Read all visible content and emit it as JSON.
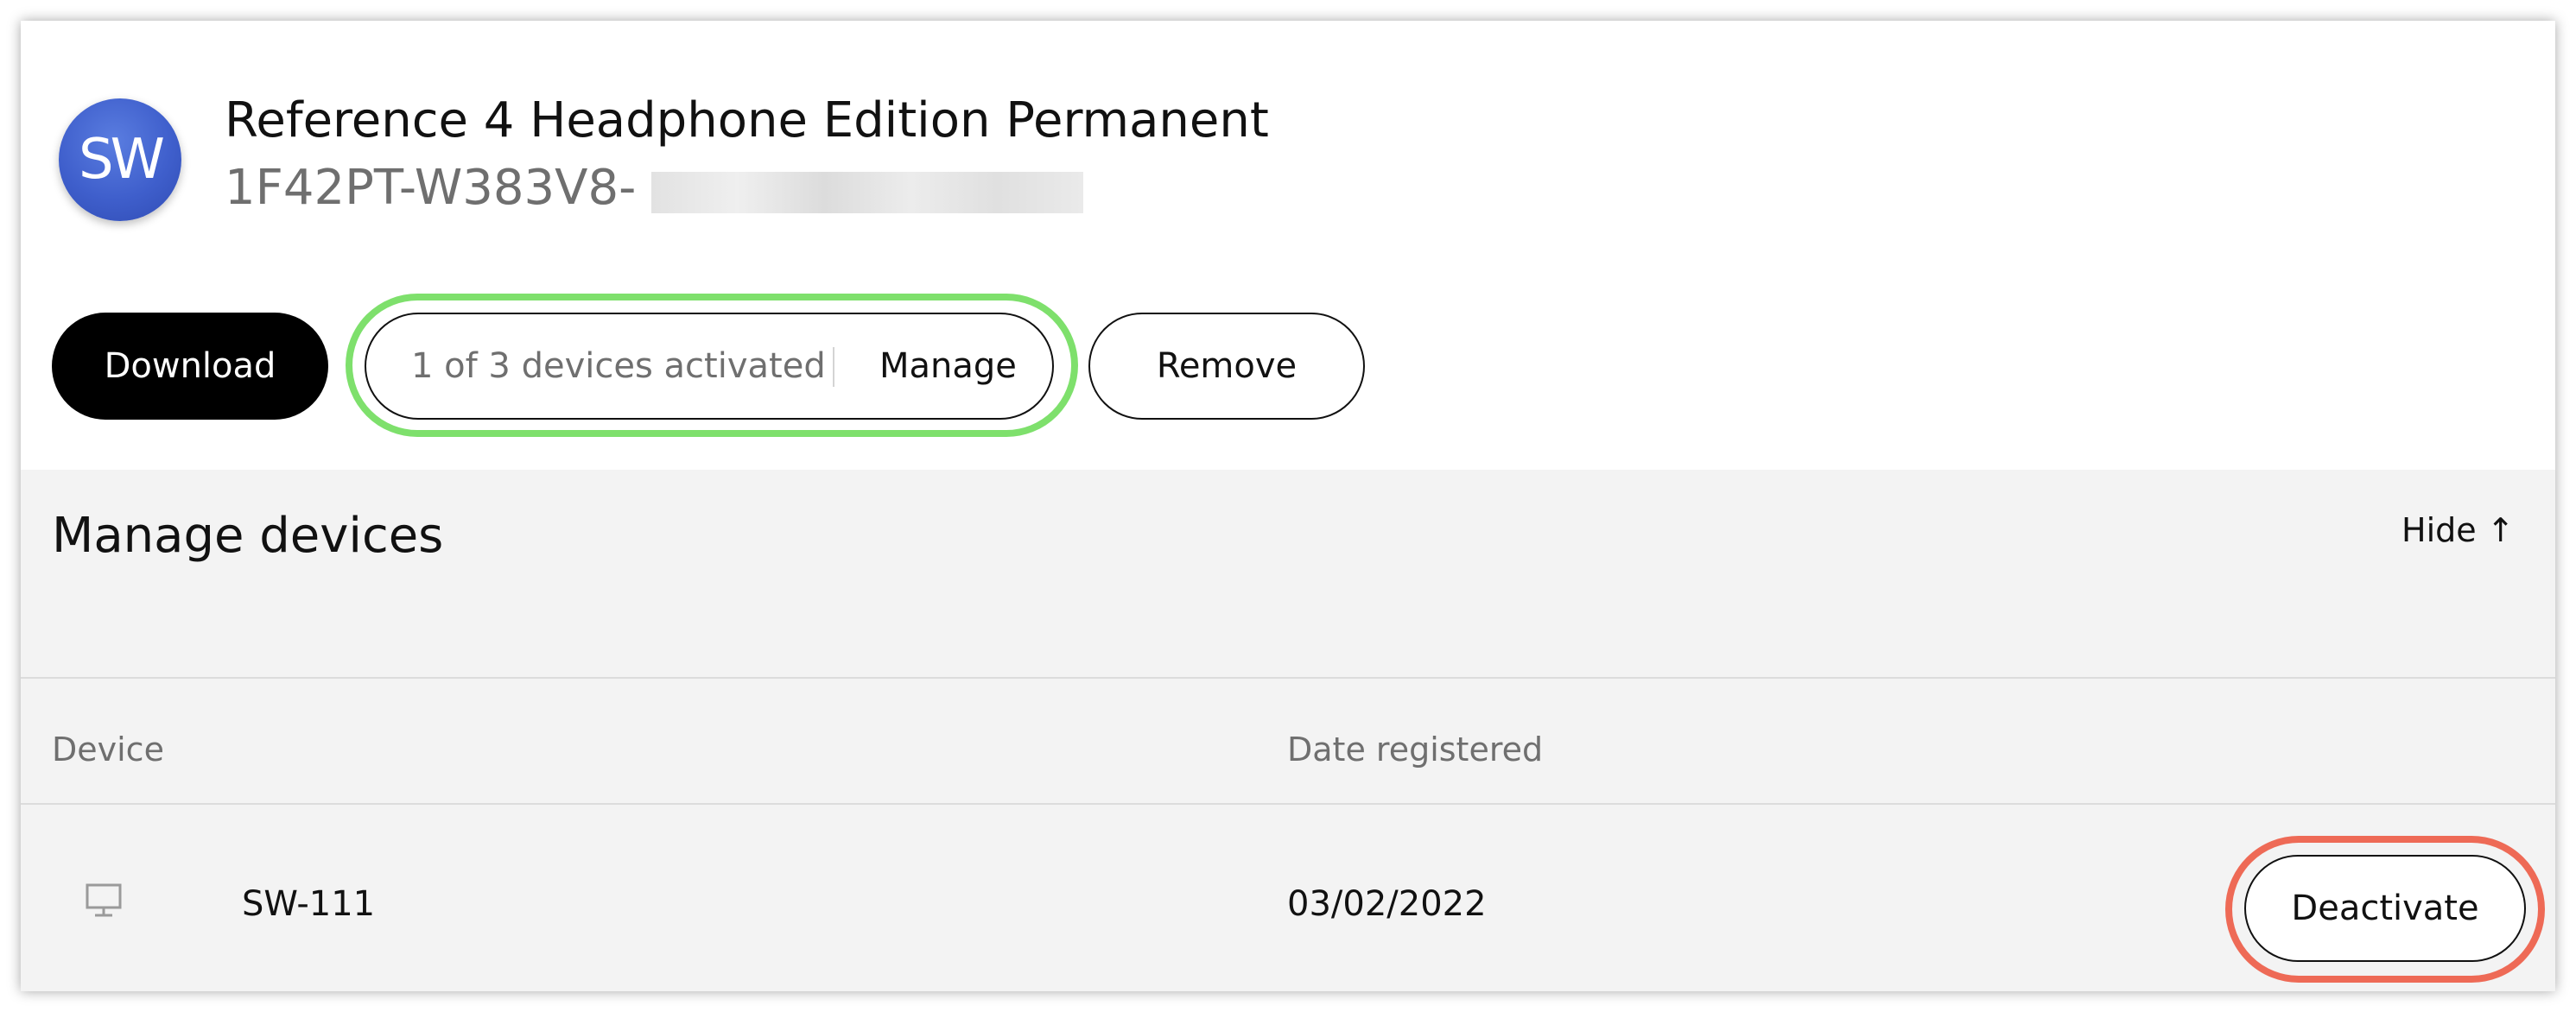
{
  "product": {
    "logo_text": "SW",
    "title": "Reference 4 Headphone Edition Permanent",
    "serial_visible": "1F42PT-W383V8-"
  },
  "actions": {
    "download_label": "Download",
    "activation_count": "1 of 3 devices activated",
    "manage_label": "Manage",
    "remove_label": "Remove"
  },
  "manage_devices": {
    "title": "Manage devices",
    "hide_label": "Hide ↑",
    "columns": [
      "Device",
      "Date registered"
    ],
    "rows": [
      {
        "icon": "desktop-icon",
        "device": "SW-111",
        "date_registered": "03/02/2022",
        "action_label": "Deactivate"
      }
    ]
  },
  "colors": {
    "highlight_green": "#7ee06c",
    "highlight_red": "#ee6a56",
    "logo_blue": "#3f5fcc",
    "panel_background": "#f3f3f3"
  }
}
